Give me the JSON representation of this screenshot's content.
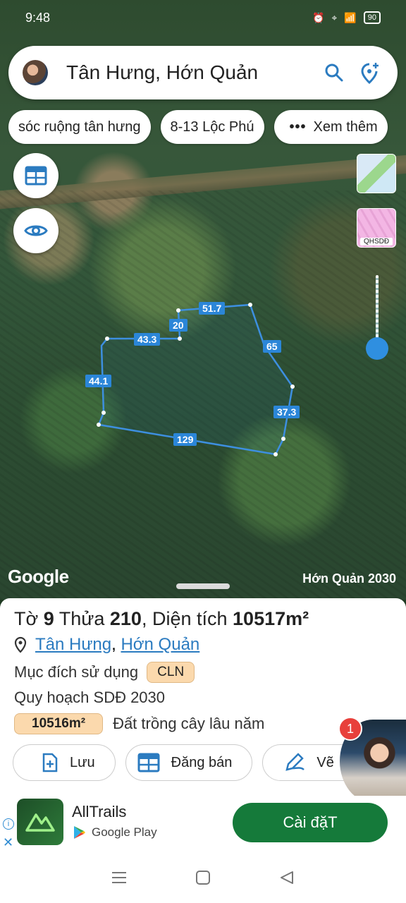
{
  "status": {
    "time": "9:48",
    "battery": "90"
  },
  "search": {
    "title": "Tân Hưng, Hớn Quản"
  },
  "chips": [
    {
      "label": "sóc ruộng tân hưng"
    },
    {
      "label": "8-13 Lộc Phú"
    },
    {
      "label": "Xem thêm"
    }
  ],
  "map": {
    "edge_labels": [
      "51.7",
      "20",
      "43.3",
      "65",
      "44.1",
      "37.3",
      "129"
    ],
    "layer_label": "QHSDĐ",
    "attribution": "Google",
    "caption": "Hớn Quản 2030"
  },
  "parcel": {
    "to_label": "Tờ",
    "to_number": "9",
    "thua_label": "Thửa",
    "thua_number": "210",
    "area_label": ", Diện tích",
    "area_value": "10517m²",
    "place_1": "Tân Hưng",
    "place_sep": ",",
    "place_2": "Hớn Quản",
    "purpose_label": "Mục đích sử dụng",
    "purpose_code": "CLN",
    "plan_label": "Quy hoạch SDĐ 2030",
    "plan_area": "10516m²",
    "plan_desc": "Đất trồng cây lâu năm"
  },
  "actions": [
    {
      "label": "Lưu"
    },
    {
      "label": "Đăng bán"
    },
    {
      "label": "Vẽ"
    }
  ],
  "notification_count": "1",
  "ad": {
    "app_name": "AllTrails",
    "store": "Google Play",
    "install": "Cài đặT"
  },
  "colors": {
    "accent": "#2b86d8",
    "install": "#157a3a",
    "badge": "#fbd9ad"
  }
}
